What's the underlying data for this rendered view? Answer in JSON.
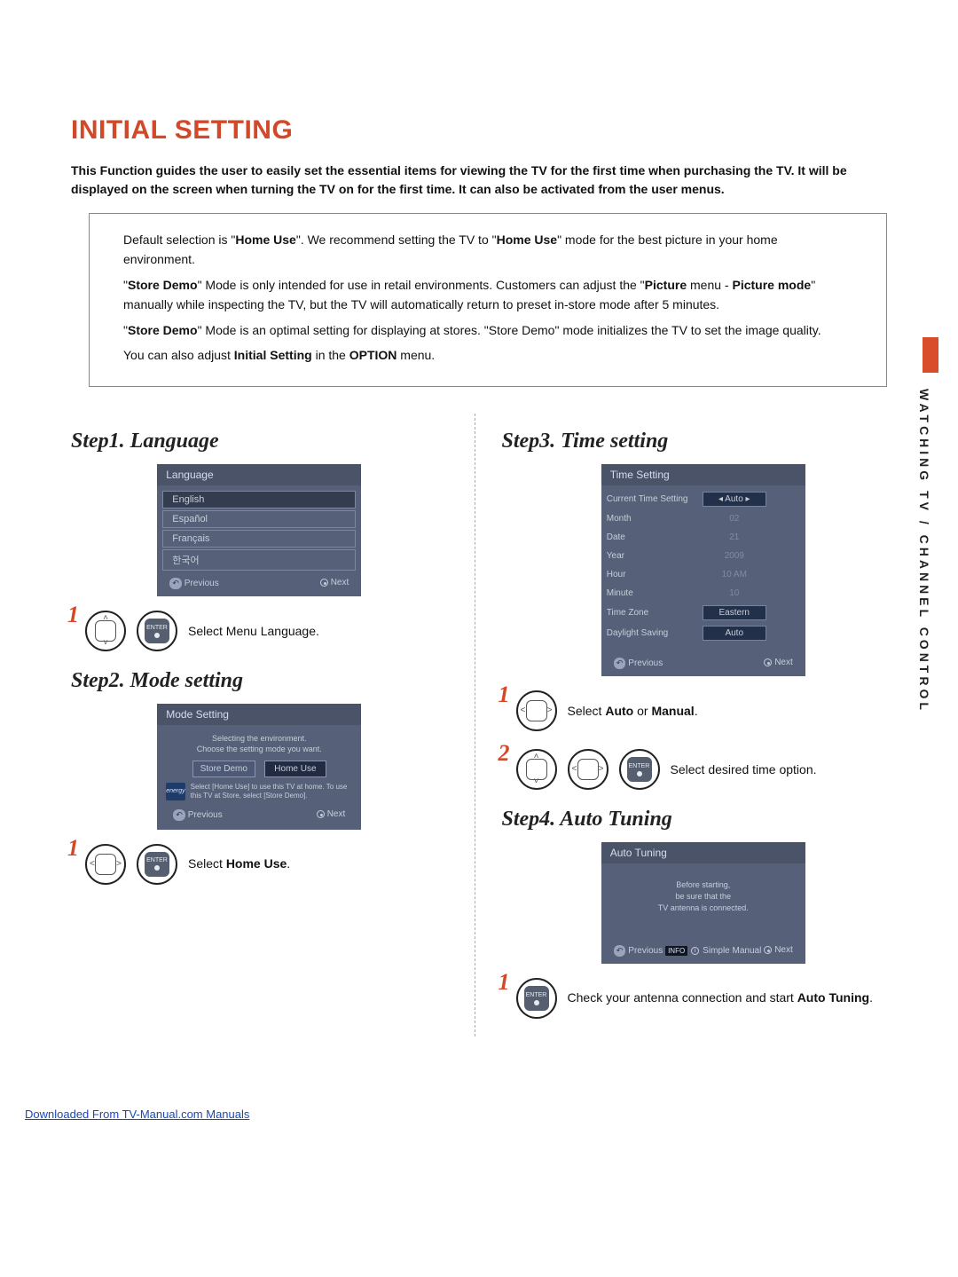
{
  "title": "INITIAL SETTING",
  "lead": "This Function guides the user to easily set the essential items for viewing the TV for the first time when purchasing the TV. It will be displayed on the screen when turning the TV on for the first time. It can also be activated from the user menus.",
  "infobox": {
    "p1a": "Default selection is \"",
    "p1b_home": "Home Use",
    "p1c": "\". We recommend setting the TV to \"",
    "p1d_home": "Home Use",
    "p1e": "\" mode for the best picture in your home environment.",
    "p2a": "\"",
    "p2b_store": "Store Demo",
    "p2c": "\" Mode is only intended for use in retail environments. Customers can adjust the \"",
    "p2d_picture": "Picture",
    "p2e": " menu - ",
    "p2f_pmode": "Picture mode",
    "p2g": "\" manually while inspecting the TV, but the TV will automatically return to preset in-store mode after 5 minutes.",
    "p3a": "\"",
    "p3b_store": "Store Demo",
    "p3c": "\" Mode is an optimal setting for displaying at stores. \"Store Demo\" mode initializes the TV to set the image quality.",
    "p4a": "You can also adjust ",
    "p4b_initial": "Initial Setting",
    "p4c": " in the ",
    "p4d_option": "OPTION",
    "p4e": " menu."
  },
  "steps": {
    "s1": "Step1. Language",
    "s2": "Step2. Mode setting",
    "s3": "Step3. Time setting",
    "s4": "Step4. Auto Tuning"
  },
  "language_panel": {
    "title": "Language",
    "options": [
      "English",
      "Español",
      "Français",
      "한국어"
    ],
    "prev": "Previous",
    "next": "Next"
  },
  "lang_instr": "Select Menu Language.",
  "mode_panel": {
    "title": "Mode Setting",
    "msg1": "Selecting the environment.",
    "msg2": "Choose the setting mode you want.",
    "btn_store": "Store Demo",
    "btn_home": "Home Use",
    "hint": "Select [Home Use] to use this TV at home. To use this TV at Store, select [Store Demo].",
    "star_label": "energy",
    "prev": "Previous",
    "next": "Next"
  },
  "mode_instr_a": "Select ",
  "mode_instr_b": "Home Use",
  "mode_instr_c": ".",
  "time_panel": {
    "title": "Time Setting",
    "rows": [
      {
        "k": "Current Time Setting",
        "v": "Auto",
        "type": "btn-tri"
      },
      {
        "k": "Month",
        "v": "02",
        "type": "faded"
      },
      {
        "k": "Date",
        "v": "21",
        "type": "faded"
      },
      {
        "k": "Year",
        "v": "2009",
        "type": "faded"
      },
      {
        "k": "Hour",
        "v": "10 AM",
        "type": "faded"
      },
      {
        "k": "Minute",
        "v": "10",
        "type": "faded"
      },
      {
        "k": "Time Zone",
        "v": "Eastern",
        "type": "btn"
      },
      {
        "k": "Daylight Saving",
        "v": "Auto",
        "type": "btn"
      }
    ],
    "prev": "Previous",
    "next": "Next"
  },
  "time_instr1_a": "Select ",
  "time_instr1_b": "Auto",
  "time_instr1_c": " or ",
  "time_instr1_d": "Manual",
  "time_instr1_e": ".",
  "time_instr2": "Select desired time option.",
  "auto_panel": {
    "title": "Auto Tuning",
    "body1": "Before starting,",
    "body2": "be sure that the",
    "body3": "TV antenna is connected.",
    "prev": "Previous",
    "info": "INFO",
    "simple": "Simple Manual",
    "next": "Next"
  },
  "auto_instr_a": "Check your antenna connection and start ",
  "auto_instr_b": "Auto Tuning",
  "auto_instr_c": ".",
  "enter_label": "ENTER",
  "sidebar_text": "WATCHING TV / CHANNEL CONTROL",
  "footer": "Downloaded From TV-Manual.com Manuals"
}
